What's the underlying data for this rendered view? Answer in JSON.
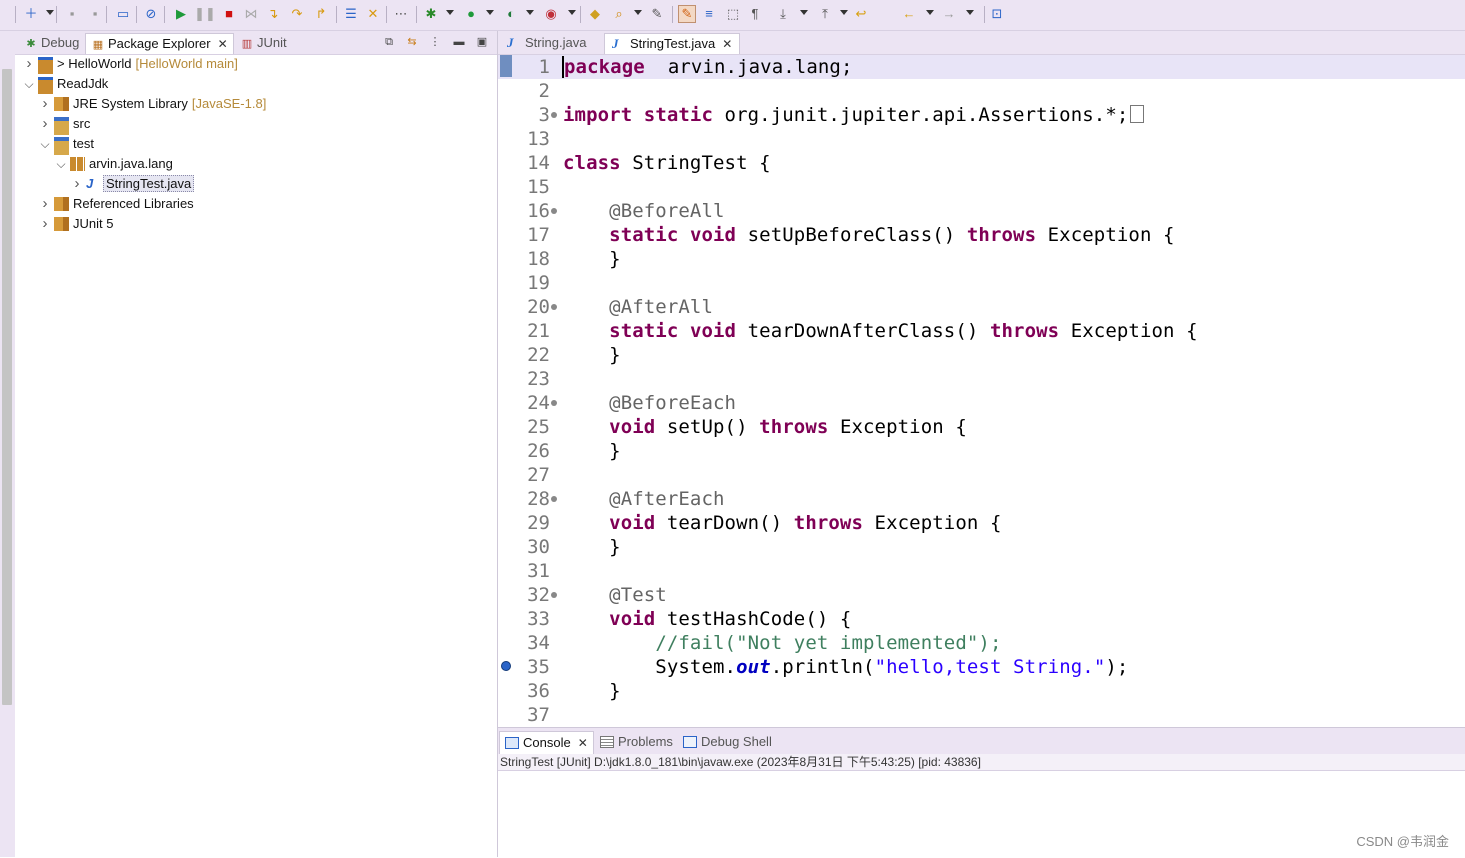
{
  "toolbar": {
    "icons": [
      "new-icon",
      "save-icon",
      "save-all-icon",
      "monitor-icon",
      "skip-breakpoints-icon",
      "resume-icon",
      "suspend-icon",
      "terminate-icon",
      "disconnect-icon",
      "step-into-icon",
      "step-over-icon",
      "step-return-icon",
      "open-console-icon",
      "drop-to-frame-icon",
      "use-step-filters-icon",
      "debug-icon",
      "run-icon",
      "coverage-icon",
      "external-tools-icon",
      "open-type-icon",
      "search-icon",
      "annotation-icon",
      "toggle-mark-occurrences-icon",
      "word-wrap-icon",
      "block-selection-icon",
      "show-whitespace-icon",
      "next-annotation-icon",
      "previous-annotation-icon",
      "last-edit-icon",
      "back-icon",
      "forward-icon",
      "pin-editor-icon"
    ]
  },
  "left_views": {
    "tabs": [
      {
        "label": "Debug",
        "icon": "bug-icon",
        "active": false
      },
      {
        "label": "Package Explorer",
        "icon": "package-explorer-icon",
        "active": true
      },
      {
        "label": "JUnit",
        "icon": "junit-icon",
        "active": false
      }
    ],
    "tools": [
      "collapse-all-icon",
      "link-with-editor-icon",
      "view-menu-icon",
      "minimize-icon",
      "maximize-icon"
    ]
  },
  "tree": [
    {
      "label": "> HelloWorld",
      "decoration": "[HelloWorld main]",
      "icon": "project-icon",
      "expanded": false
    },
    {
      "label": "ReadJdk",
      "decoration": "",
      "icon": "project-icon",
      "expanded": true
    },
    {
      "label": "JRE System Library",
      "decoration": "[JavaSE-1.8]",
      "icon": "library-icon",
      "expanded": false
    },
    {
      "label": "src",
      "decoration": "",
      "icon": "source-folder-icon",
      "expanded": false
    },
    {
      "label": "test",
      "decoration": "",
      "icon": "source-folder-icon",
      "expanded": true
    },
    {
      "label": "arvin.java.lang",
      "decoration": "",
      "icon": "package-icon",
      "expanded": true
    },
    {
      "label": "StringTest.java",
      "decoration": "",
      "icon": "junit-java-file-icon",
      "expanded": false
    },
    {
      "label": "Referenced Libraries",
      "decoration": "",
      "icon": "library-icon",
      "expanded": false
    },
    {
      "label": "JUnit 5",
      "decoration": "",
      "icon": "library-icon",
      "expanded": false
    }
  ],
  "editor": {
    "tabs": [
      {
        "label": "String.java",
        "active": false
      },
      {
        "label": "StringTest.java",
        "active": true
      }
    ],
    "lines": [
      {
        "n": "1",
        "tokens": [
          [
            "kw",
            "package"
          ],
          [
            "",
            "  arvin.java.lang;"
          ]
        ]
      },
      {
        "n": "2",
        "tokens": []
      },
      {
        "n": "3",
        "tokens": [
          [
            "kw",
            "import"
          ],
          [
            "",
            " "
          ],
          [
            "kw",
            "static"
          ],
          [
            "",
            " org.junit.jupiter.api.Assertions.*;"
          ]
        ]
      },
      {
        "n": "13",
        "tokens": []
      },
      {
        "n": "14",
        "tokens": [
          [
            "kw",
            "class"
          ],
          [
            "",
            " StringTest {"
          ]
        ]
      },
      {
        "n": "15",
        "tokens": []
      },
      {
        "n": "16",
        "tokens": [
          [
            "",
            "    "
          ],
          [
            "an",
            "@BeforeAll"
          ]
        ]
      },
      {
        "n": "17",
        "tokens": [
          [
            "",
            "    "
          ],
          [
            "kw",
            "static"
          ],
          [
            "",
            " "
          ],
          [
            "kw",
            "void"
          ],
          [
            "",
            " setUpBeforeClass() "
          ],
          [
            "kw",
            "throws"
          ],
          [
            "",
            " Exception {"
          ]
        ]
      },
      {
        "n": "18",
        "tokens": [
          [
            "",
            "    }"
          ]
        ]
      },
      {
        "n": "19",
        "tokens": []
      },
      {
        "n": "20",
        "tokens": [
          [
            "",
            "    "
          ],
          [
            "an",
            "@AfterAll"
          ]
        ]
      },
      {
        "n": "21",
        "tokens": [
          [
            "",
            "    "
          ],
          [
            "kw",
            "static"
          ],
          [
            "",
            " "
          ],
          [
            "kw",
            "void"
          ],
          [
            "",
            " tearDownAfterClass() "
          ],
          [
            "kw",
            "throws"
          ],
          [
            "",
            " Exception {"
          ]
        ]
      },
      {
        "n": "22",
        "tokens": [
          [
            "",
            "    }"
          ]
        ]
      },
      {
        "n": "23",
        "tokens": []
      },
      {
        "n": "24",
        "tokens": [
          [
            "",
            "    "
          ],
          [
            "an",
            "@BeforeEach"
          ]
        ]
      },
      {
        "n": "25",
        "tokens": [
          [
            "",
            "    "
          ],
          [
            "kw",
            "void"
          ],
          [
            "",
            " setUp() "
          ],
          [
            "kw",
            "throws"
          ],
          [
            "",
            " Exception {"
          ]
        ]
      },
      {
        "n": "26",
        "tokens": [
          [
            "",
            "    }"
          ]
        ]
      },
      {
        "n": "27",
        "tokens": []
      },
      {
        "n": "28",
        "tokens": [
          [
            "",
            "    "
          ],
          [
            "an",
            "@AfterEach"
          ]
        ]
      },
      {
        "n": "29",
        "tokens": [
          [
            "",
            "    "
          ],
          [
            "kw",
            "void"
          ],
          [
            "",
            " tearDown() "
          ],
          [
            "kw",
            "throws"
          ],
          [
            "",
            " Exception {"
          ]
        ]
      },
      {
        "n": "30",
        "tokens": [
          [
            "",
            "    }"
          ]
        ]
      },
      {
        "n": "31",
        "tokens": []
      },
      {
        "n": "32",
        "tokens": [
          [
            "",
            "    "
          ],
          [
            "an",
            "@Test"
          ]
        ]
      },
      {
        "n": "33",
        "tokens": [
          [
            "",
            "    "
          ],
          [
            "kw",
            "void"
          ],
          [
            "",
            " testHashCode() {"
          ]
        ]
      },
      {
        "n": "34",
        "tokens": [
          [
            "",
            "        "
          ],
          [
            "cm",
            "//fail(\"Not yet implemented\");"
          ]
        ]
      },
      {
        "n": "35",
        "tokens": [
          [
            "",
            "        System."
          ],
          [
            "fld",
            "out"
          ],
          [
            "",
            ".println("
          ],
          [
            "st",
            "\"hello,test String.\""
          ],
          [
            "",
            ");"
          ]
        ]
      },
      {
        "n": "36",
        "tokens": [
          [
            "",
            "    }"
          ]
        ]
      },
      {
        "n": "37",
        "tokens": []
      }
    ]
  },
  "console": {
    "tabs": [
      {
        "label": "Console",
        "icon": "console-icon",
        "active": true
      },
      {
        "label": "Problems",
        "icon": "problems-icon",
        "active": false
      },
      {
        "label": "Debug Shell",
        "icon": "debug-shell-icon",
        "active": false
      }
    ],
    "status": "StringTest [JUnit] D:\\jdk1.8.0_181\\bin\\javaw.exe  (2023年8月31日 下午5:43:25) [pid: 43836]"
  },
  "watermark": "CSDN @韦润金",
  "colors": {
    "keyword": "#7f0055",
    "annotation": "#646464",
    "string": "#2a00ff",
    "comment": "#3f7f5f",
    "field": "#0000c0",
    "chrome": "#ece4f3"
  }
}
